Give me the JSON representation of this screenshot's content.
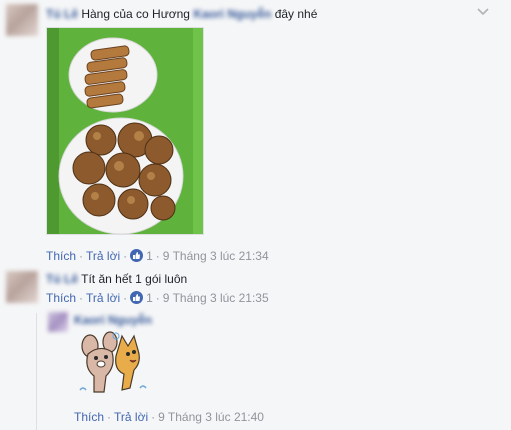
{
  "comments": [
    {
      "name": "Tú Lê",
      "text_before": "Hàng của co Hương",
      "mention": "Kaori Nguyễn",
      "text_after": "đây nhé",
      "photo_alt": "plate of grilled food",
      "actions": {
        "like": "Thích",
        "reply": "Trả lời",
        "like_count": "1",
        "time": "9 Tháng 3 lúc 21:34"
      }
    },
    {
      "name": "Tú Lê",
      "text": "Tít ăn hết 1 gói luôn",
      "actions": {
        "like": "Thích",
        "reply": "Trả lời",
        "like_count": "1",
        "time": "9 Tháng 3 lúc 21:35"
      }
    }
  ],
  "reply": {
    "name": "Kaori Nguyễn",
    "sticker": "dancing-animals-sticker",
    "actions": {
      "like": "Thích",
      "reply": "Trả lời",
      "time": "9 Tháng 3 lúc 21:40"
    }
  },
  "icons": {
    "options": "chevron-down-icon",
    "like": "thumbs-up-icon"
  },
  "colors": {
    "link": "#4267b2",
    "name": "#365899",
    "meta": "#90949c",
    "photo_bg": "#5fb33c"
  }
}
